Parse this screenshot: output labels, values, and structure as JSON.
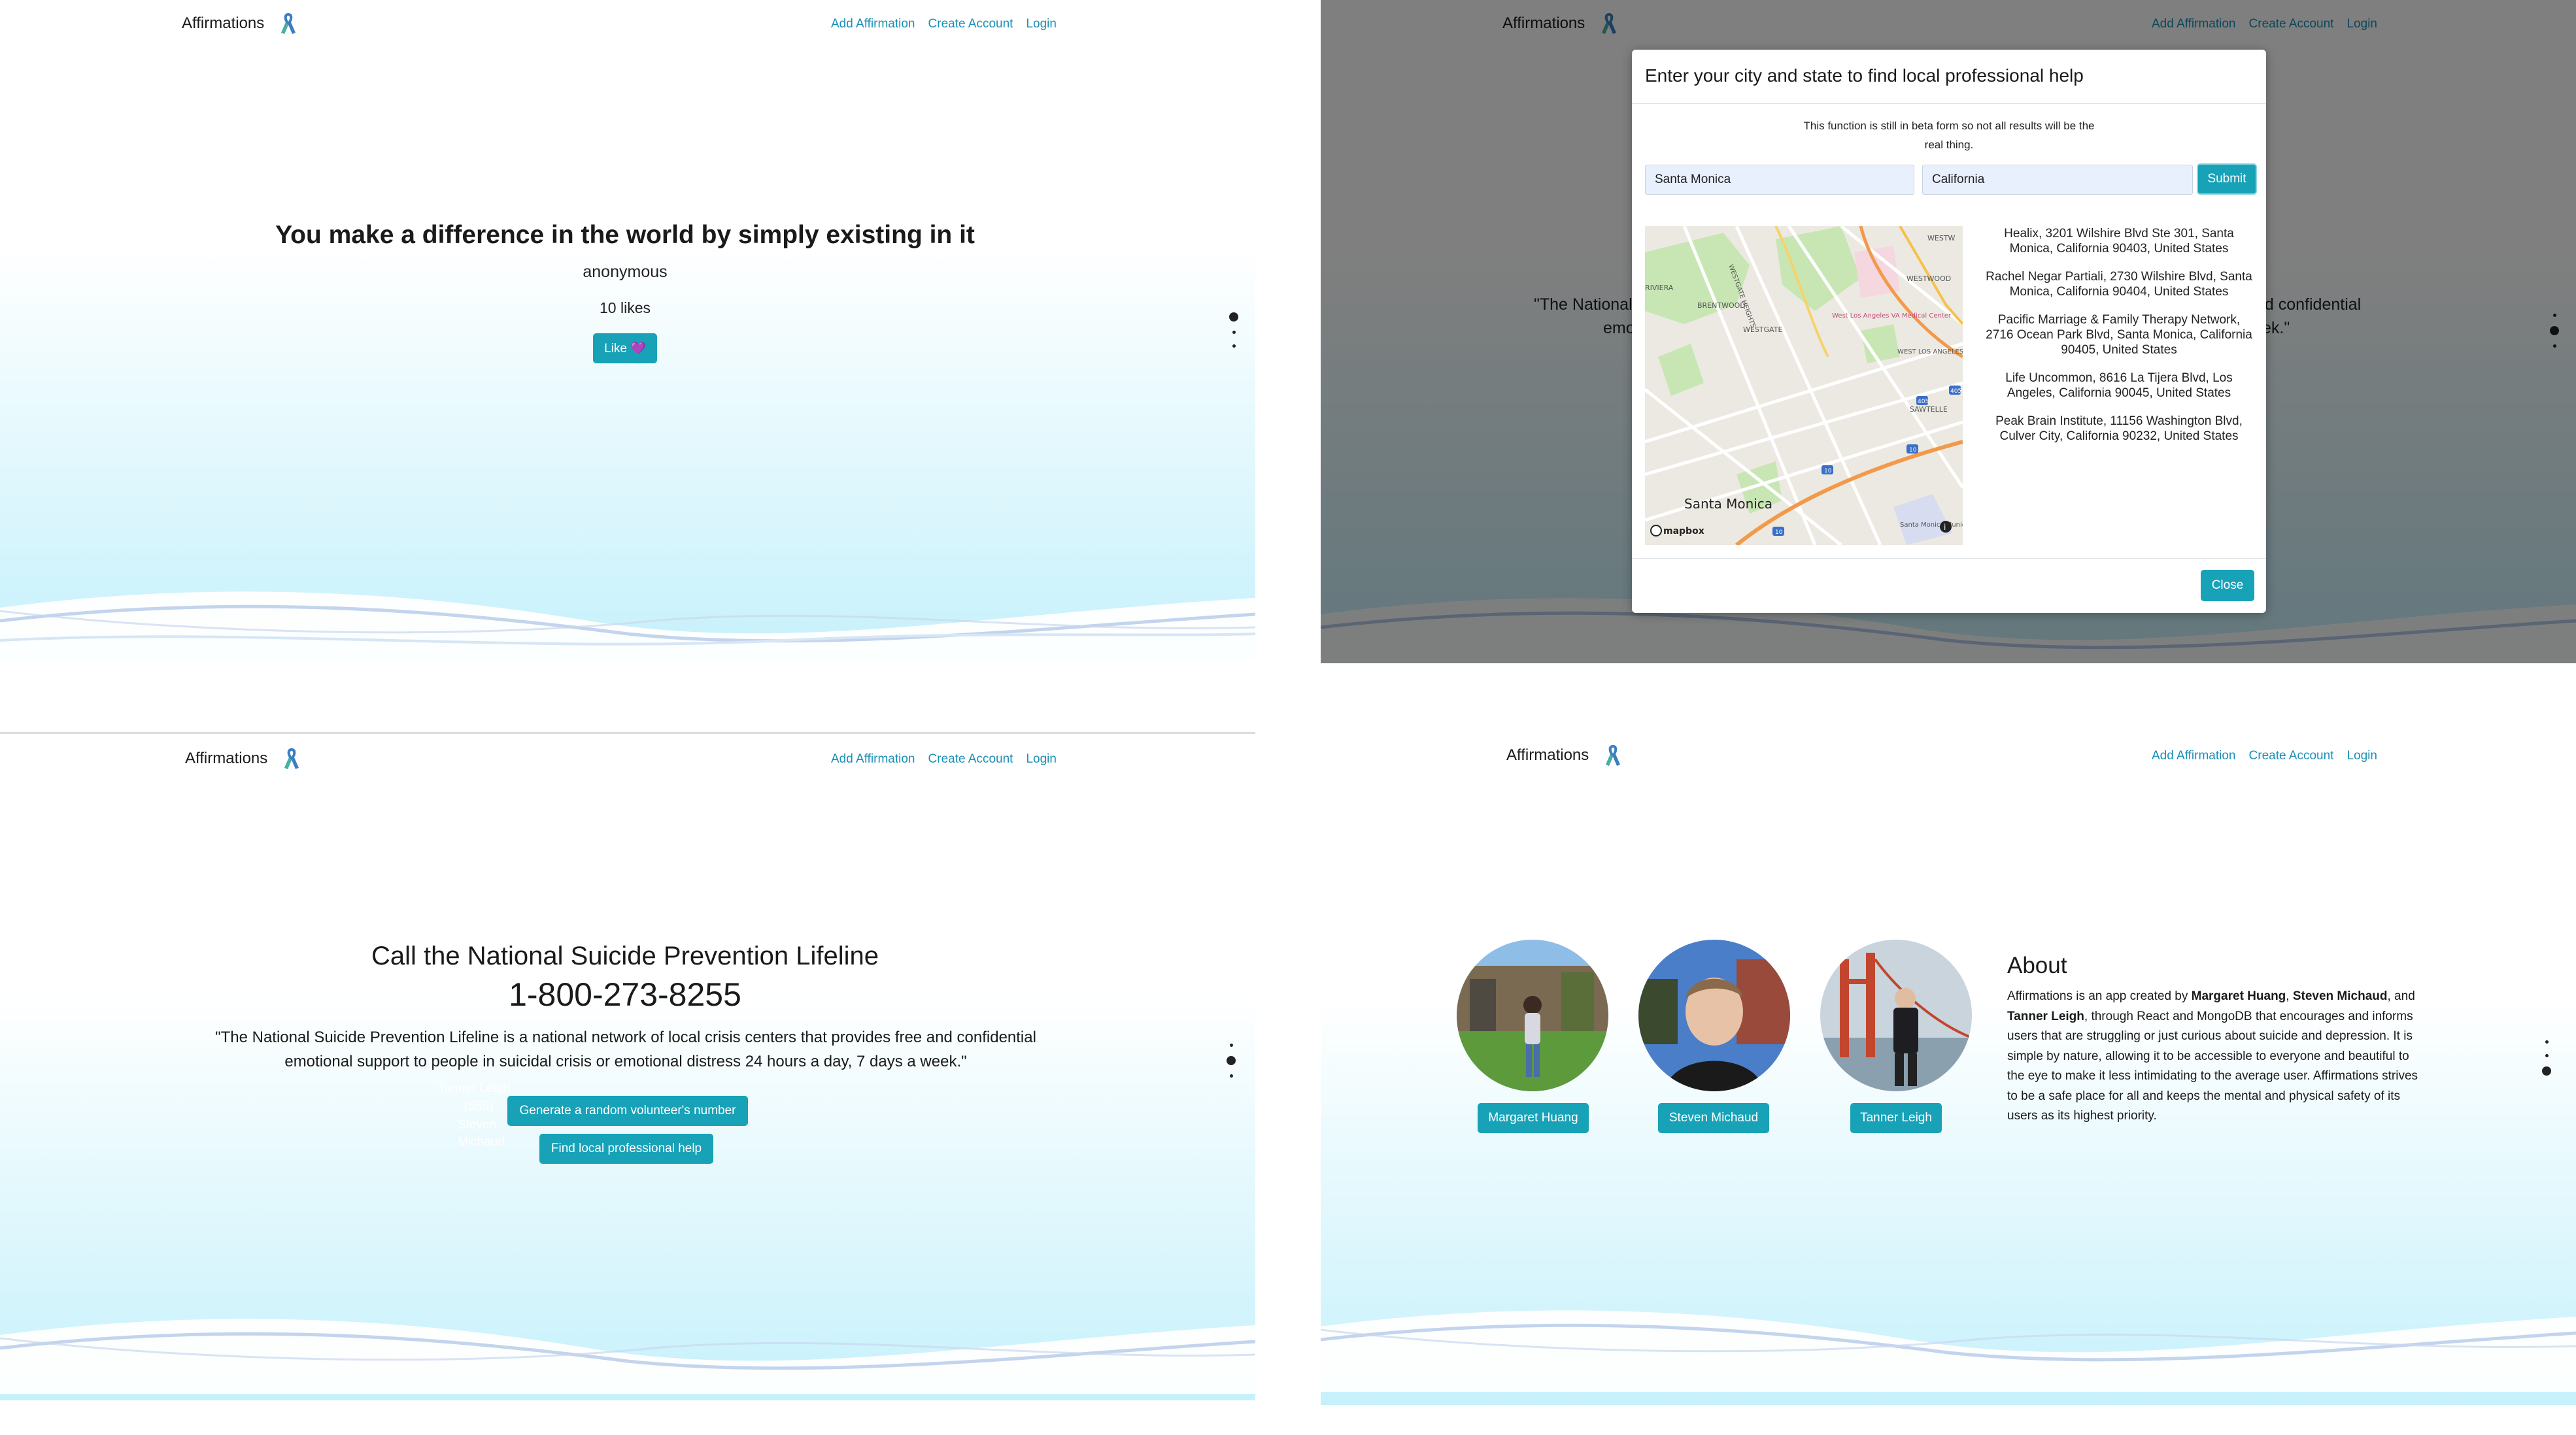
{
  "nav": {
    "brand": "Affirmations",
    "links": [
      "Add Affirmation",
      "Create Account",
      "Login"
    ]
  },
  "affirmation": {
    "text": "You make a difference in the world by simply existing in it",
    "author": "anonymous",
    "likes": "10 likes",
    "like_button": "Like 💜"
  },
  "modal": {
    "title": "Enter your city and state to find local professional help",
    "note": "This function is still in beta form so not all results will be the real thing.",
    "city_value": "Santa Monica",
    "state_value": "California",
    "submit_label": "Submit",
    "close_label": "Close",
    "results": [
      "Healix, 3201 Wilshire Blvd Ste 301, Santa Monica, California 90403, United States",
      "Rachel Negar Partiali, 2730 Wilshire Blvd, Santa Monica, California 90404, United States",
      "Pacific Marriage & Family Therapy Network, 2716 Ocean Park Blvd, Santa Monica, California 90405, United States",
      "Life Uncommon, 8616 La Tijera Blvd, Los Angeles, California 90045, United States",
      "Peak Brain Institute, 11156 Washington Blvd, Culver City, California 90232, United States"
    ],
    "map": {
      "city_label": "Santa Monica",
      "labels": {
        "westgate_heights": "WESTGATE HEIGHTS",
        "brentwood": "BRENTWOOD",
        "westgate": "WESTGATE",
        "riviera": "RIVIERA",
        "westwood": "WESTWOOD",
        "west_la": "WEST LOS ANGELES",
        "sawtelle": "SAWTELLE",
        "va_center": "West Los Angeles VA Medical Center",
        "airport": "Santa Monica Municipal Airport",
        "westw": "WESTW"
      },
      "shields": [
        "405",
        "10",
        "10",
        "10",
        "405"
      ],
      "attribution": "mapbox",
      "info": "i"
    },
    "background_left": "\"The National",
    "background_left2": "emo",
    "background_right": "nd confidential",
    "background_right2": "ek.\""
  },
  "lifeline": {
    "heading": "Call the National Suicide Prevention Lifeline",
    "phone": "1-800-273-8255",
    "quote": "\"The National Suicide Prevention Lifeline is a national network of local crisis centers that provides free and confidential emotional support to people in suicidal crisis or emotional distress 24 hours a day, 7 days a week.\"",
    "volunteer_button": "Generate a random volunteer's number",
    "local_help_button": "Find local professional help",
    "ghost_lines": [
      "Tanner Leigh",
      "(555)",
      "Steven",
      "Michaud"
    ]
  },
  "about": {
    "title": "About",
    "body_parts": {
      "p1": "Affirmations is an app created by ",
      "n1": "Margaret Huang",
      "p2": ", ",
      "n2": "Steven Michaud",
      "p3": ", and ",
      "n3": "Tanner Leigh",
      "p4": ", through React and MongoDB that encourages and informs users that are struggling or just curious about suicide and depression. It is simple by nature, allowing it to be accessible to everyone and beautiful to the eye to make it less intimidating to the average user. Affirmations strives to be a safe place for all and keeps the mental and physical safety of its users as its highest priority."
    },
    "team": [
      "Margaret Huang",
      "Steven Michaud",
      "Tanner Leigh"
    ]
  },
  "colors": {
    "accent": "#17a2b8",
    "link": "#1a8fb8",
    "gradient_top": "#ffffff",
    "gradient_bottom": "#c6f1fb",
    "overlay": "rgba(0,0,0,0.5)"
  }
}
